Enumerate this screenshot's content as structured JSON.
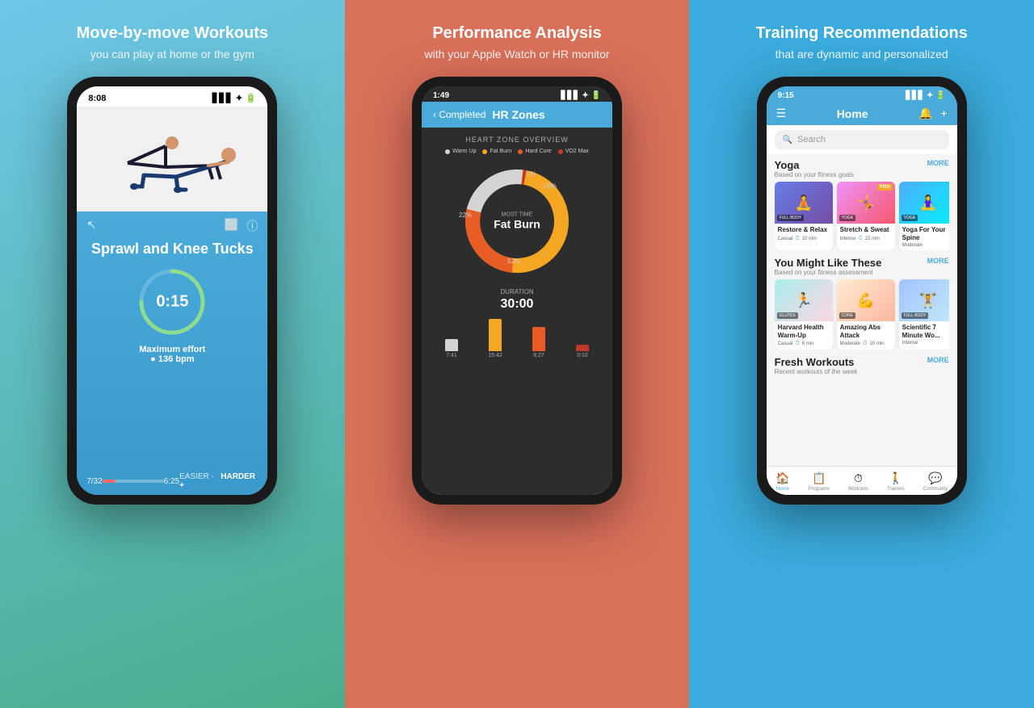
{
  "panels": [
    {
      "id": "panel-1",
      "title": "Move-by-move Workouts",
      "subtitle": "you can play at home or the gym",
      "phone": {
        "status_time": "8:08",
        "exercise_name": "Sprawl and Knee Tucks",
        "timer": "0:15",
        "effort_label": "Maximum effort",
        "bpm": "136 bpm",
        "progress": "7/32",
        "duration": "6:25",
        "easier": "EASIER -",
        "harder": "HARDER +"
      }
    },
    {
      "id": "panel-2",
      "title": "Performance Analysis",
      "subtitle": "with your Apple Watch or HR monitor",
      "phone": {
        "status_time": "1:49",
        "back_label": "Completed",
        "screen_title": "HR Zones",
        "chart_title": "HEART ZONE OVERVIEW",
        "legend": [
          {
            "label": "Warm Up",
            "color": "#d4d4d4"
          },
          {
            "label": "Fat Burn",
            "color": "#f5a623"
          },
          {
            "label": "Hard Core",
            "color": "#e85d26"
          },
          {
            "label": "VO2 Max",
            "color": "#c0392b"
          }
        ],
        "pct_labels": [
          {
            "value": "1%",
            "top": "18%",
            "left": "58%"
          },
          {
            "value": "22%",
            "top": "42%",
            "left": "8%"
          },
          {
            "value": "26%",
            "top": "20%",
            "left": "68%"
          },
          {
            "value": "52%",
            "top": "78%",
            "left": "42%"
          }
        ],
        "most_time_label": "MOST TIME",
        "fat_burn_label": "Fat Burn",
        "duration_label": "DURATION",
        "duration_time": "30:00",
        "bars": [
          {
            "label": "7:41",
            "height": 15,
            "color": "#d4d4d4"
          },
          {
            "label": "15:42",
            "height": 40,
            "color": "#f5a623"
          },
          {
            "label": "6:27",
            "height": 30,
            "color": "#e85d26"
          },
          {
            "label": "0:10",
            "height": 8,
            "color": "#c0392b"
          }
        ]
      }
    },
    {
      "id": "panel-3",
      "title": "Training Recommendations",
      "subtitle": "that are dynamic and personalized",
      "phone": {
        "status_time": "9:15",
        "nav_title": "Home",
        "search_placeholder": "Search",
        "sections": [
          {
            "title": "Yoga",
            "subtitle": "Based on your fitness goals",
            "more": "MORE",
            "cards": [
              {
                "title": "Restore & Relax",
                "tag": "FULL BODY",
                "level": "Casual",
                "time": "10 min",
                "badge": null,
                "bg": "yoga-bg-1"
              },
              {
                "title": "Stretch & Sweat",
                "tag": "YOGA",
                "level": "Intense",
                "time": "22 min",
                "badge": "PRO",
                "bg": "yoga-bg-2"
              },
              {
                "title": "Yoga For Your Spine",
                "tag": "YOGA",
                "level": "Moderate",
                "time": null,
                "badge": null,
                "bg": "yoga-bg-3"
              }
            ]
          },
          {
            "title": "You Might Like These",
            "subtitle": "Based on your fitness assessment",
            "more": "MORE",
            "cards": [
              {
                "title": "Harvard Health Warm-Up",
                "tag": "GLUTES",
                "level": "Casual",
                "time": "6 min",
                "badge": null,
                "bg": "harvard-bg"
              },
              {
                "title": "Amazing Abs Attack",
                "tag": "CORE",
                "level": "Moderate",
                "time": "10 min",
                "badge": null,
                "bg": "abs-bg"
              },
              {
                "title": "Scientific 7 Minute Wo...",
                "tag": "FULL BODY",
                "level": "Intense",
                "time": null,
                "badge": null,
                "bg": "sci-bg"
              }
            ]
          },
          {
            "title": "Fresh Workouts",
            "subtitle": "Recent workouts of the week",
            "more": "MORE"
          }
        ],
        "bottom_nav": [
          {
            "label": "Home",
            "icon": "🏠",
            "active": true
          },
          {
            "label": "Programs",
            "icon": "📋",
            "active": false
          },
          {
            "label": "Workouts",
            "icon": "⏱",
            "active": false
          },
          {
            "label": "Trainers",
            "icon": "🚶",
            "active": false
          },
          {
            "label": "Community",
            "icon": "💬",
            "active": false
          }
        ]
      }
    }
  ]
}
